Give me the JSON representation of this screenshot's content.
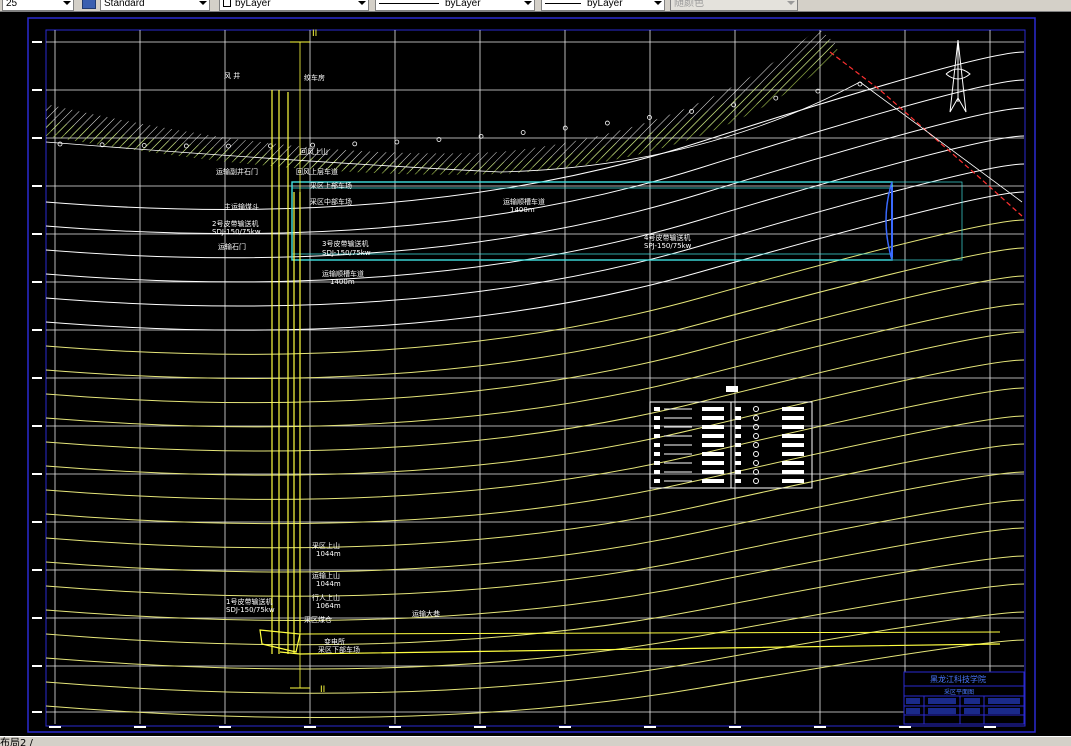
{
  "toolbar": {
    "scale_value": "25",
    "text_style": "Standard",
    "layer": "byLayer",
    "linetype": "byLayer",
    "lineweight": "byLayer",
    "color": "随颜色"
  },
  "drawing": {
    "section_mark_top": "II",
    "section_mark_bottom": "II",
    "shaft_label": "风 井",
    "shaft_label_right": "绞车房",
    "main_roadway": "运输大巷",
    "labels": {
      "l1": "运输副井石门",
      "l2": "回风上山",
      "l3": "主运输煤斗",
      "l4": "运输石门",
      "l5": "回风上层车道",
      "l6": "采区上部车场",
      "l7": "采区中部车场",
      "l8": "3号皮带输送机",
      "l9": "SDJ-150/75kw",
      "l10": "运输顺槽车道",
      "l11": "1400m",
      "l12": "2号皮带输送机",
      "l13": "SDJ-150/75kw",
      "l14": "运输石门",
      "l15": "运输顺槽车道",
      "l16": "1400m",
      "l17": "4号皮带输送机",
      "l18": "SPJ-150/75kw",
      "l19": "采区上山",
      "l20": "1044m",
      "l21": "运输上山",
      "l22": "1044m",
      "l23": "行人上山",
      "l24": "1064m",
      "l25": "1号皮带输送机",
      "l26": "SDJ-150/75kw",
      "l27": "采区煤仓",
      "l28": "变电所",
      "l29": "采区下部车场"
    }
  },
  "title_block": {
    "school": "黑龙江科技学院",
    "drawing_name": "采区平面图"
  },
  "status": {
    "layout_tab": "布局2 /"
  }
}
